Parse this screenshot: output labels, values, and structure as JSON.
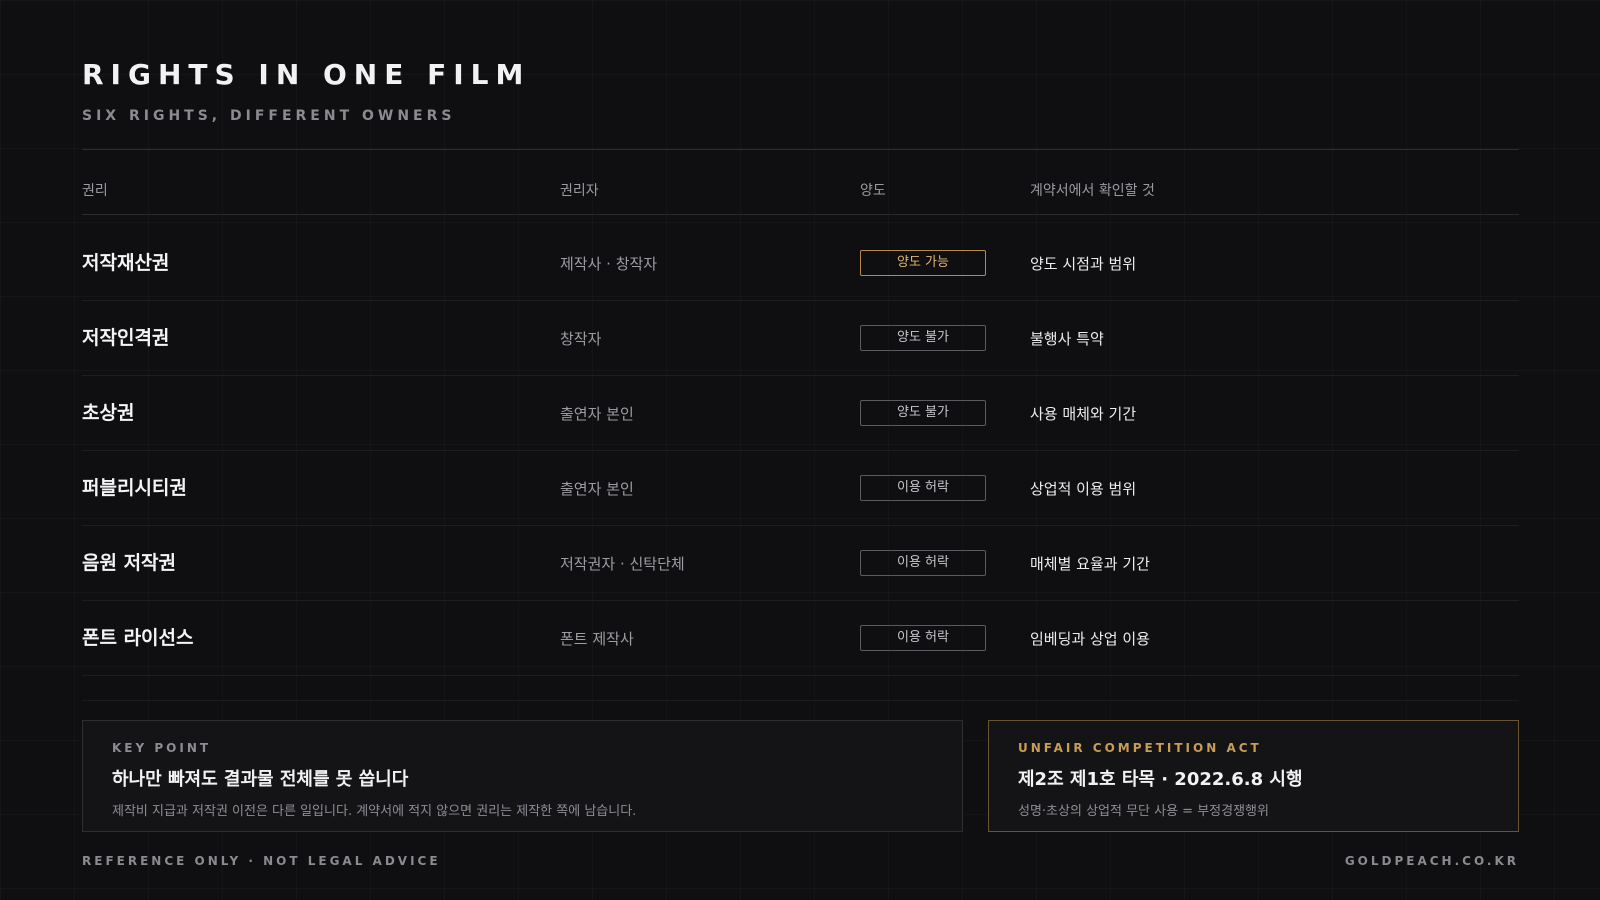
{
  "header": {
    "title": "RIGHTS IN ONE FILM",
    "subtitle": "SIX RIGHTS, DIFFERENT OWNERS"
  },
  "table": {
    "columns": [
      "권리",
      "권리자",
      "양도",
      "계약서에서 확인할 것"
    ],
    "rows": [
      {
        "right": "저작재산권",
        "holder": "제작사 · 창작자",
        "transfer": "양도 가능",
        "check": "양도 시점과 범위"
      },
      {
        "right": "저작인격권",
        "holder": "창작자",
        "transfer": "양도 불가",
        "check": "불행사 특약"
      },
      {
        "right": "초상권",
        "holder": "출연자 본인",
        "transfer": "양도 불가",
        "check": "사용 매체와 기간"
      },
      {
        "right": "퍼블리시티권",
        "holder": "출연자 본인",
        "transfer": "이용 허락",
        "check": "상업적 이용 범위"
      },
      {
        "right": "음원 저작권",
        "holder": "저작권자 · 신탁단체",
        "transfer": "이용 허락",
        "check": "매체별 요율과 기간"
      },
      {
        "right": "폰트 라이선스",
        "holder": "폰트 제작사",
        "transfer": "이용 허락",
        "check": "임베딩과 상업 이용"
      }
    ]
  },
  "key_point": {
    "kicker": "KEY POINT",
    "headline": "하나만 빠져도 결과물 전체를 못 씁니다",
    "description": "제작비 지급과 저작권 이전은 다른 일입니다. 계약서에 적지 않으면 권리는 제작한 쪽에 남습니다."
  },
  "law": {
    "kicker": "UNFAIR COMPETITION ACT",
    "headline": "제2조 제1호 타목 · 2022.6.8 시행",
    "description": "성명·초상의 상업적 무단 사용 = 부정경쟁행위"
  },
  "footer": {
    "disclaimer": "REFERENCE ONLY · NOT LEGAL ADVICE",
    "site": "GOLDPEACH.CO.KR"
  },
  "colors": {
    "background": "#0f0f12",
    "accent_gold": "#c99d56",
    "badge_gold_text": "#e0b470"
  }
}
